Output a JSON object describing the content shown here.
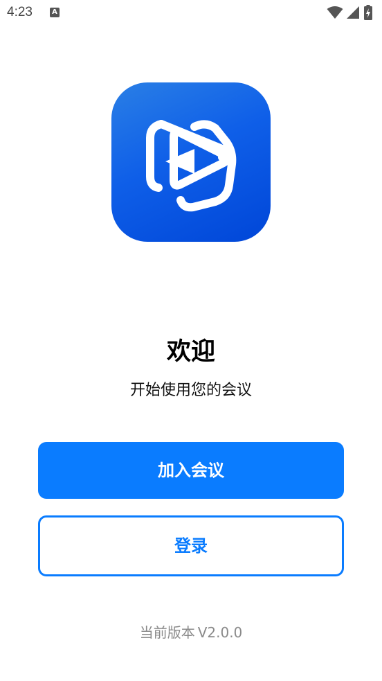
{
  "status_bar": {
    "time": "4:23",
    "notification_icon": "A",
    "icons": [
      "text-notification-icon",
      "wifi-icon",
      "signal-icon",
      "battery-charging-icon"
    ]
  },
  "logo": {
    "icon": "play-triangle-logo-icon",
    "colors": {
      "gradient_start": "#2a7fe6",
      "gradient_end": "#0046d8",
      "mark": "#ffffff"
    }
  },
  "welcome": {
    "title": "欢迎",
    "subtitle": "开始使用您的会议"
  },
  "actions": {
    "join_label": "加入会议",
    "login_label": "登录"
  },
  "footer": {
    "version_label": "当前版本",
    "version_number": "V2.0.0"
  },
  "colors": {
    "accent": "#0a7cff",
    "background": "#ffffff",
    "muted_text": "#8a8a8a"
  }
}
